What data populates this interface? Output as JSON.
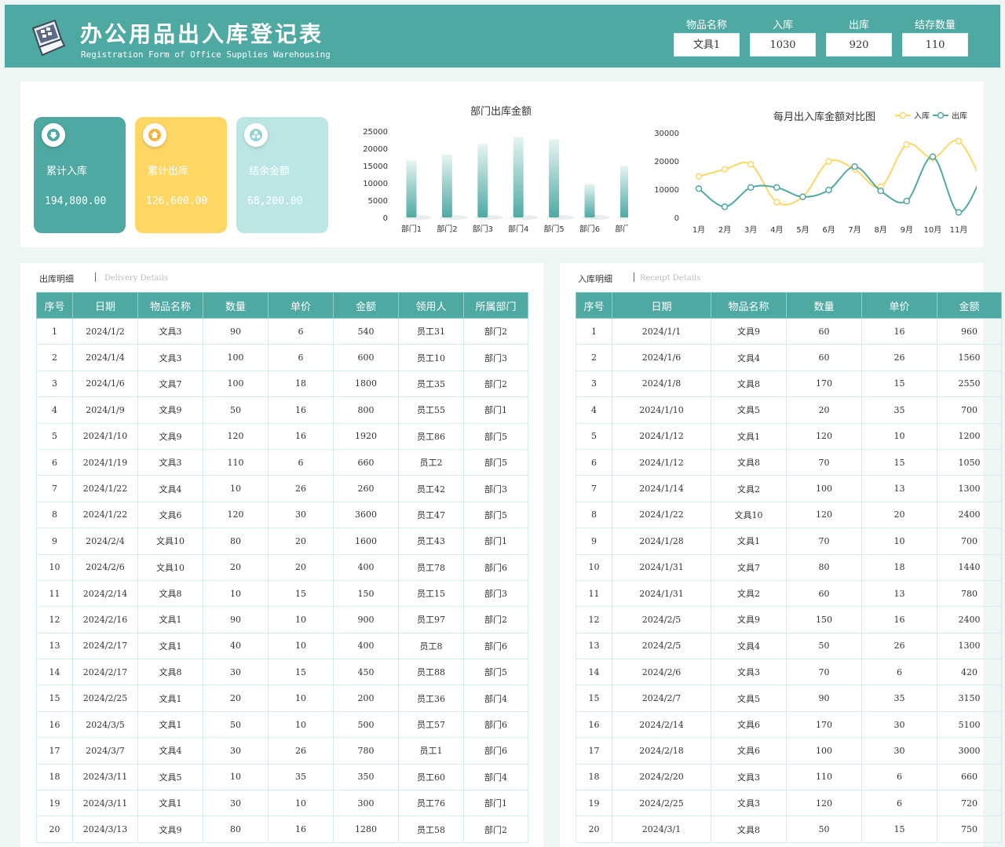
{
  "header": {
    "title": "办公用品出入库登记表",
    "subtitle": "Registration Form of Office Supplies Warehousing",
    "fields": [
      {
        "label": "物品名称",
        "value": "文具1"
      },
      {
        "label": "入库",
        "value": "1030"
      },
      {
        "label": "出库",
        "value": "920"
      },
      {
        "label": "结存数量",
        "value": "110"
      }
    ]
  },
  "cards": {
    "in": {
      "title": "累计入库",
      "value": "194,800.00",
      "icon": "arrow-down-icon"
    },
    "out": {
      "title": "累计出库",
      "value": "126,600.00",
      "icon": "arrow-up-icon"
    },
    "bal": {
      "title": "结余金额",
      "value": "68,200.00",
      "icon": "coins-icon"
    }
  },
  "colors": {
    "teal": "#4fa9a3",
    "yellow": "#fdd664",
    "lightblue": "#bce6e6"
  },
  "chart_data": [
    {
      "type": "bar",
      "title": "部门出库金额",
      "categories": [
        "部门1",
        "部门2",
        "部门3",
        "部门4",
        "部门5",
        "部门6",
        "部门7"
      ],
      "values": [
        16500,
        18200,
        21300,
        23300,
        22600,
        9700,
        15000
      ],
      "ylim": [
        0,
        25000
      ],
      "yticks": [
        0,
        5000,
        10000,
        15000,
        20000,
        25000
      ]
    },
    {
      "type": "line",
      "title": "每月出入库金额对比图",
      "categories": [
        "1月",
        "2月",
        "3月",
        "4月",
        "5月",
        "6月",
        "7月",
        "8月",
        "9月",
        "10月",
        "11月",
        "12月"
      ],
      "series": [
        {
          "name": "入库",
          "color": "#fdd664",
          "values": [
            14500,
            17000,
            18800,
            5400,
            7300,
            19800,
            17000,
            10800,
            25800,
            21000,
            27000,
            10500
          ]
        },
        {
          "name": "出库",
          "color": "#4fa9a3",
          "values": [
            10200,
            3800,
            10600,
            10600,
            7300,
            9700,
            18000,
            9400,
            5800,
            21500,
            1800,
            17000
          ]
        }
      ],
      "ylim": [
        0,
        30000
      ],
      "yticks": [
        0,
        10000,
        20000,
        30000
      ],
      "legend": "top-right"
    }
  ],
  "out_section": {
    "title": "出库明细",
    "subtitle": "Delivery Details",
    "headers": [
      "序号",
      "日期",
      "物品名称",
      "数量",
      "单价",
      "金额",
      "领用人",
      "所属部门"
    ],
    "rows": [
      [
        "1",
        "2024/1/2",
        "文具3",
        "90",
        "6",
        "540",
        "员工31",
        "部门2"
      ],
      [
        "2",
        "2024/1/4",
        "文具3",
        "100",
        "6",
        "600",
        "员工10",
        "部门3"
      ],
      [
        "3",
        "2024/1/6",
        "文具7",
        "100",
        "18",
        "1800",
        "员工35",
        "部门2"
      ],
      [
        "4",
        "2024/1/9",
        "文具9",
        "50",
        "16",
        "800",
        "员工55",
        "部门1"
      ],
      [
        "5",
        "2024/1/10",
        "文具9",
        "120",
        "16",
        "1920",
        "员工86",
        "部门5"
      ],
      [
        "6",
        "2024/1/19",
        "文具3",
        "110",
        "6",
        "660",
        "员工2",
        "部门5"
      ],
      [
        "7",
        "2024/1/22",
        "文具4",
        "10",
        "26",
        "260",
        "员工42",
        "部门3"
      ],
      [
        "8",
        "2024/1/22",
        "文具6",
        "120",
        "30",
        "3600",
        "员工47",
        "部门5"
      ],
      [
        "9",
        "2024/2/4",
        "文具10",
        "80",
        "20",
        "1600",
        "员工43",
        "部门1"
      ],
      [
        "10",
        "2024/2/6",
        "文具10",
        "20",
        "20",
        "400",
        "员工78",
        "部门6"
      ],
      [
        "11",
        "2024/2/14",
        "文具8",
        "10",
        "15",
        "150",
        "员工15",
        "部门3"
      ],
      [
        "12",
        "2024/2/16",
        "文具1",
        "90",
        "10",
        "900",
        "员工97",
        "部门2"
      ],
      [
        "13",
        "2024/2/17",
        "文具1",
        "40",
        "10",
        "400",
        "员工8",
        "部门6"
      ],
      [
        "14",
        "2024/2/17",
        "文具8",
        "30",
        "15",
        "450",
        "员工88",
        "部门5"
      ],
      [
        "15",
        "2024/2/25",
        "文具1",
        "20",
        "10",
        "200",
        "员工36",
        "部门4"
      ],
      [
        "16",
        "2024/3/5",
        "文具1",
        "50",
        "10",
        "500",
        "员工57",
        "部门6"
      ],
      [
        "17",
        "2024/3/7",
        "文具4",
        "30",
        "26",
        "780",
        "员工1",
        "部门6"
      ],
      [
        "18",
        "2024/3/11",
        "文具5",
        "10",
        "35",
        "350",
        "员工60",
        "部门4"
      ],
      [
        "19",
        "2024/3/11",
        "文具1",
        "30",
        "10",
        "300",
        "员工76",
        "部门1"
      ],
      [
        "20",
        "2024/3/13",
        "文具9",
        "80",
        "16",
        "1280",
        "员工58",
        "部门2"
      ]
    ]
  },
  "in_section": {
    "title": "入库明细",
    "subtitle": "Receipt Details",
    "headers": [
      "序号",
      "日期",
      "物品名称",
      "数量",
      "单价",
      "金额"
    ],
    "rows": [
      [
        "1",
        "2024/1/1",
        "文具9",
        "60",
        "16",
        "960"
      ],
      [
        "2",
        "2024/1/6",
        "文具4",
        "60",
        "26",
        "1560"
      ],
      [
        "3",
        "2024/1/8",
        "文具8",
        "170",
        "15",
        "2550"
      ],
      [
        "4",
        "2024/1/10",
        "文具5",
        "20",
        "35",
        "700"
      ],
      [
        "5",
        "2024/1/12",
        "文具1",
        "120",
        "10",
        "1200"
      ],
      [
        "6",
        "2024/1/12",
        "文具8",
        "70",
        "15",
        "1050"
      ],
      [
        "7",
        "2024/1/14",
        "文具2",
        "100",
        "13",
        "1300"
      ],
      [
        "8",
        "2024/1/22",
        "文具10",
        "120",
        "20",
        "2400"
      ],
      [
        "9",
        "2024/1/28",
        "文具1",
        "70",
        "10",
        "700"
      ],
      [
        "10",
        "2024/1/31",
        "文具7",
        "80",
        "18",
        "1440"
      ],
      [
        "11",
        "2024/1/31",
        "文具2",
        "60",
        "13",
        "780"
      ],
      [
        "12",
        "2024/2/5",
        "文具9",
        "150",
        "16",
        "2400"
      ],
      [
        "13",
        "2024/2/5",
        "文具4",
        "50",
        "26",
        "1300"
      ],
      [
        "14",
        "2024/2/6",
        "文具3",
        "70",
        "6",
        "420"
      ],
      [
        "15",
        "2024/2/7",
        "文具5",
        "90",
        "35",
        "3150"
      ],
      [
        "16",
        "2024/2/14",
        "文具6",
        "170",
        "30",
        "5100"
      ],
      [
        "17",
        "2024/2/18",
        "文具6",
        "100",
        "30",
        "3000"
      ],
      [
        "18",
        "2024/2/20",
        "文具3",
        "110",
        "6",
        "660"
      ],
      [
        "19",
        "2024/2/25",
        "文具3",
        "120",
        "6",
        "720"
      ],
      [
        "20",
        "2024/3/1",
        "文具8",
        "50",
        "15",
        "750"
      ]
    ]
  }
}
